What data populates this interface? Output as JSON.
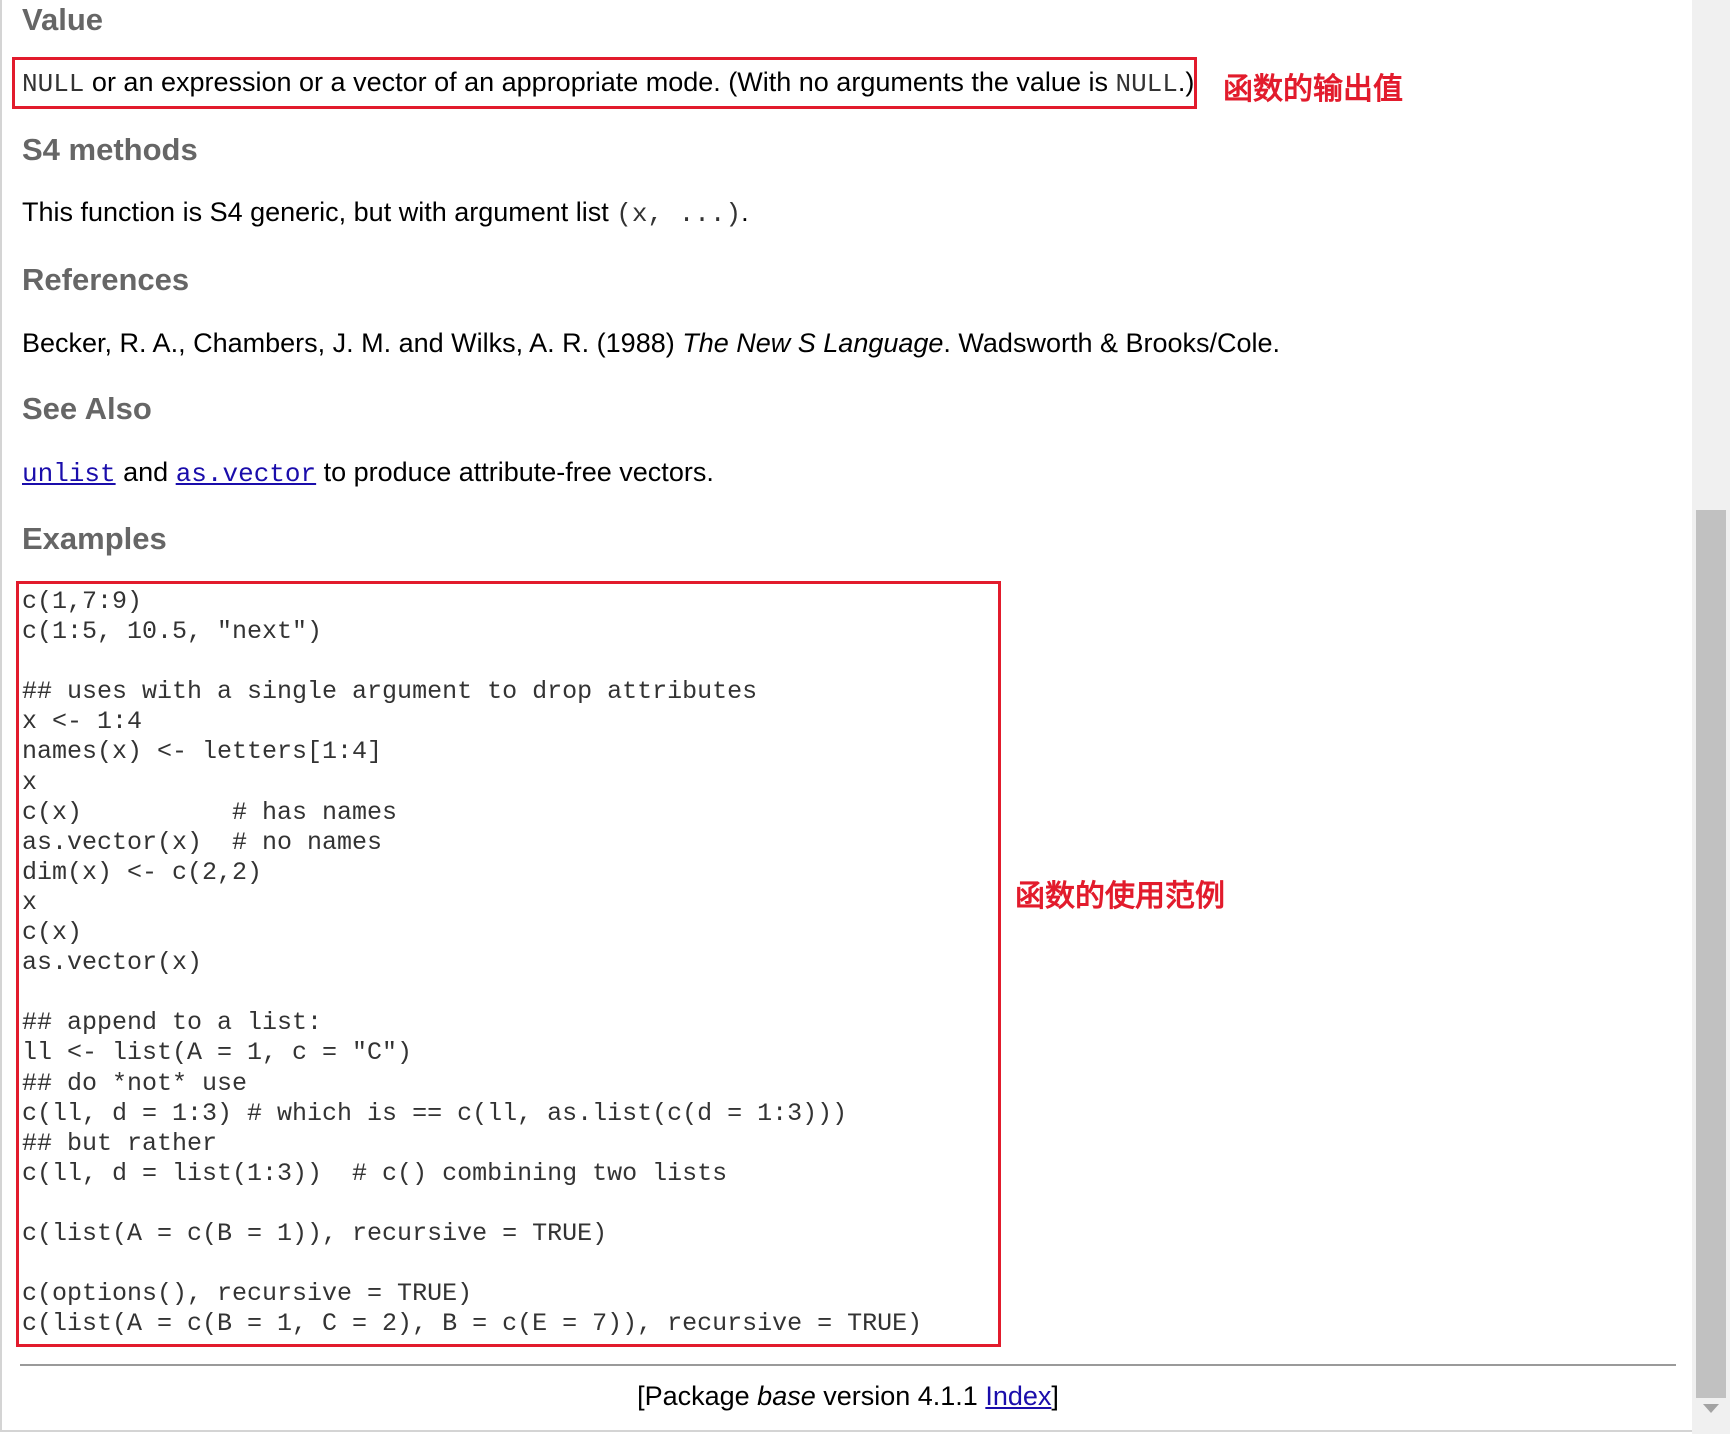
{
  "sections": {
    "value": {
      "heading": "Value",
      "null1": "NULL",
      "text1": " or an expression or a vector of an appropriate mode. (With no arguments the value is ",
      "null2": "NULL",
      "text2": ".)"
    },
    "s4": {
      "heading": "S4 methods",
      "text": "This function is S4 generic, but with argument list ",
      "code": "(x, ...)",
      "end": "."
    },
    "references": {
      "heading": "References",
      "authors": "Becker, R. A., Chambers, J. M. and Wilks, A. R. (1988) ",
      "title": "The New S Language",
      "publisher": ". Wadsworth & Brooks/Cole."
    },
    "see_also": {
      "heading": "See Also",
      "link1": "unlist",
      "and": " and ",
      "link2": "as.vector",
      "rest": " to produce attribute-free vectors."
    },
    "examples": {
      "heading": "Examples",
      "code": "c(1,7:9)\nc(1:5, 10.5, \"next\")\n\n## uses with a single argument to drop attributes\nx <- 1:4\nnames(x) <- letters[1:4]\nx\nc(x)          # has names\nas.vector(x)  # no names\ndim(x) <- c(2,2)\nx\nc(x)\nas.vector(x)\n\n## append to a list:\nll <- list(A = 1, c = \"C\")\n## do *not* use\nc(ll, d = 1:3) # which is == c(ll, as.list(c(d = 1:3)))\n## but rather\nc(ll, d = list(1:3))  # c() combining two lists\n\nc(list(A = c(B = 1)), recursive = TRUE)\n\nc(options(), recursive = TRUE)\nc(list(A = c(B = 1, C = 2), B = c(E = 7)), recursive = TRUE)"
    }
  },
  "annotations": {
    "value_note": "函数的输出值",
    "examples_note": "函数的使用范例"
  },
  "footer": {
    "open": "[Package ",
    "pkg": "base",
    "version": " version 4.1.1 ",
    "index_link": "Index",
    "close": "]"
  },
  "colors": {
    "annotation_red": "#e21b2c",
    "link": "#1a0dab",
    "heading": "#666666"
  }
}
